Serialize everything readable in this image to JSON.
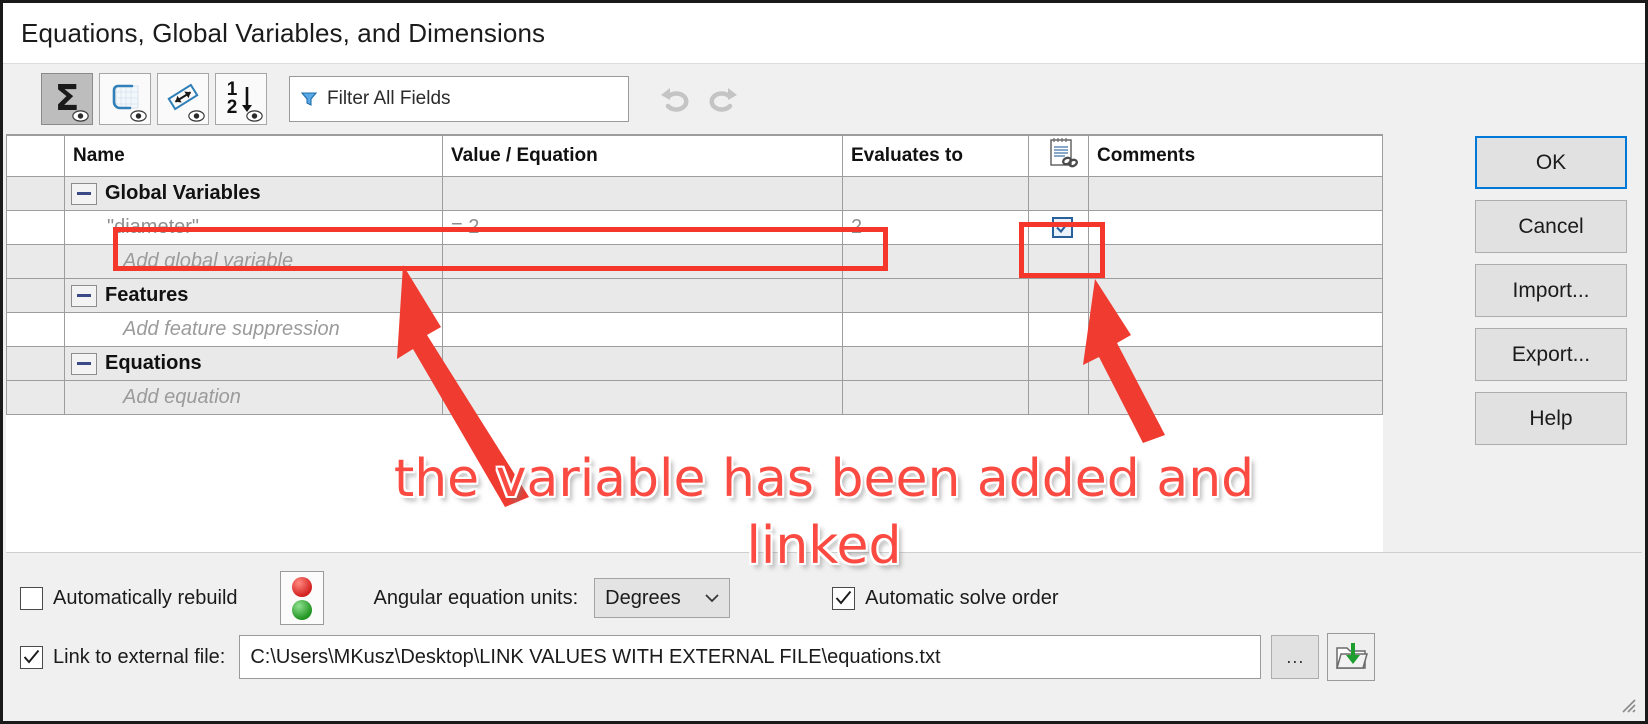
{
  "window": {
    "title": "Equations, Global Variables, and Dimensions"
  },
  "toolbar": {
    "buttons": [
      {
        "name": "global-variables-view",
        "icon": "sigma-icon",
        "active": true
      },
      {
        "name": "feature-suppression-view",
        "icon": "sketch-icon",
        "active": false
      },
      {
        "name": "equations-view",
        "icon": "dimension-icon",
        "active": false
      },
      {
        "name": "ordered-view",
        "icon": "sort-order-icon",
        "active": false
      }
    ],
    "filter": {
      "placeholder": "Filter All Fields",
      "value": "Filter All Fields",
      "icon": "filter-funnel-icon"
    },
    "undo_label": "Undo",
    "redo_label": "Redo"
  },
  "table": {
    "headers": {
      "gutter": "",
      "name": "Name",
      "value_equation": "Value / Equation",
      "evaluates_to": "Evaluates to",
      "link": "",
      "link_icon": "linked-note-icon",
      "comments": "Comments"
    },
    "rows": [
      {
        "type": "group",
        "name": "Global Variables",
        "value": "",
        "evaluates_to": "",
        "linked": null,
        "comments": ""
      },
      {
        "type": "variable",
        "name": "\"diameter\"",
        "value": "= 2",
        "evaluates_to": "2",
        "linked": true,
        "comments": ""
      },
      {
        "type": "placeholder",
        "name": "Add global variable",
        "value": "",
        "evaluates_to": "",
        "linked": null,
        "comments": ""
      },
      {
        "type": "group",
        "name": "Features",
        "value": "",
        "evaluates_to": "",
        "linked": null,
        "comments": ""
      },
      {
        "type": "placeholder",
        "name": "Add feature suppression",
        "value": "",
        "evaluates_to": "",
        "linked": null,
        "comments": ""
      },
      {
        "type": "group",
        "name": "Equations",
        "value": "",
        "evaluates_to": "",
        "linked": null,
        "comments": ""
      },
      {
        "type": "placeholder",
        "name": "Add equation",
        "value": "",
        "evaluates_to": "",
        "linked": null,
        "comments": ""
      }
    ]
  },
  "buttons": {
    "ok": "OK",
    "cancel": "Cancel",
    "import": "Import...",
    "export": "Export...",
    "help": "Help"
  },
  "bottom": {
    "automatically_rebuild": {
      "label": "Automatically rebuild",
      "checked": false
    },
    "rebuild_indicator_icon": "traffic-light-icon",
    "angular_units_label": "Angular equation units:",
    "angular_units_value": "Degrees",
    "automatic_solve_order": {
      "label": "Automatic solve order",
      "checked": true
    },
    "link_to_external_file": {
      "label": "Link to external file:",
      "checked": true
    },
    "file_path": "C:\\Users\\MKusz\\Desktop\\LINK VALUES WITH EXTERNAL FILE\\equations.txt",
    "browse_label": "...",
    "open_file_icon": "folder-import-icon"
  },
  "annotations": {
    "callout_line1": "the variable has been added and",
    "callout_line2": "linked",
    "highlight_color": "#f4372a",
    "text_color": "#fa4a42"
  }
}
